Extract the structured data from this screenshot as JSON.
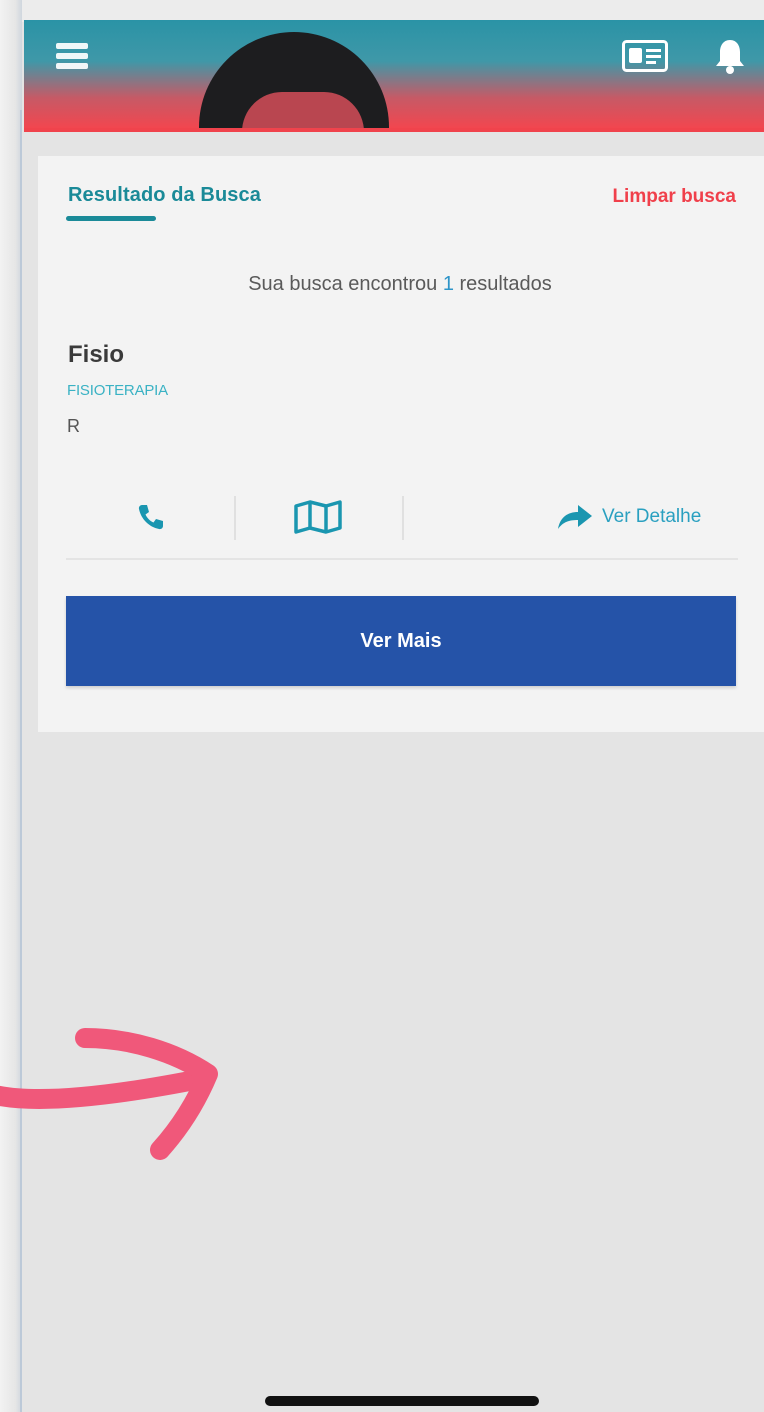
{
  "header": {
    "menu_icon": "hamburger-menu-icon",
    "card_icon": "id-card-icon",
    "bell_icon": "bell-icon",
    "colors": {
      "top": "#2a93a6",
      "bottom": "#f2464f"
    }
  },
  "search": {
    "tab_title": "Resultado da Busca",
    "clear_label": "Limpar busca",
    "summary_prefix": "Sua busca encontrou",
    "summary_count": "1",
    "summary_suffix": "resultados"
  },
  "result": {
    "name": "Fisio",
    "category": "FISIOTERAPIA",
    "extra": "R",
    "phone_icon": "phone-icon",
    "map_icon": "map-icon",
    "details_icon": "share-arrow-icon",
    "details_label": "Ver Detalhe"
  },
  "actions": {
    "more_label": "Ver Mais",
    "more_color": "#2553a8"
  },
  "colors": {
    "accent_teal": "#1a8a98",
    "accent_red": "#f0404b",
    "annotation": "#f0587a"
  }
}
